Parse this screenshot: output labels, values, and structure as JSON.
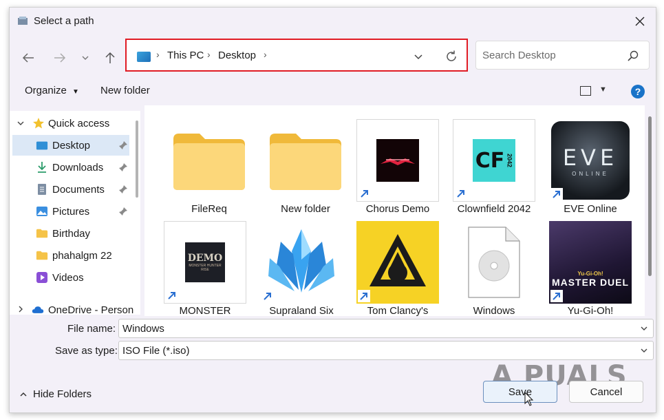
{
  "window": {
    "title": "Select a path"
  },
  "address": {
    "segments": [
      "This PC",
      "Desktop"
    ]
  },
  "search": {
    "placeholder": "Search Desktop"
  },
  "commandbar": {
    "organize": "Organize",
    "new_folder": "New folder"
  },
  "sidebar": {
    "quick_access": "Quick access",
    "items": [
      {
        "label": "Desktop",
        "icon": "desktop-icon",
        "pinned": true,
        "selected": true
      },
      {
        "label": "Downloads",
        "icon": "download-icon",
        "pinned": true
      },
      {
        "label": "Documents",
        "icon": "document-icon",
        "pinned": true
      },
      {
        "label": "Pictures",
        "icon": "pictures-icon",
        "pinned": true
      },
      {
        "label": "Birthday",
        "icon": "folder-icon"
      },
      {
        "label": "phahalgm 22",
        "icon": "folder-icon"
      },
      {
        "label": "Videos",
        "icon": "videos-icon"
      }
    ],
    "onedrive": "OneDrive - Person"
  },
  "files": [
    {
      "label": "FileReq",
      "kind": "folder"
    },
    {
      "label": "New folder",
      "kind": "folder"
    },
    {
      "label": "Chorus Demo",
      "kind": "shortcut"
    },
    {
      "label": "Clownfield 2042",
      "kind": "shortcut",
      "logo": "CF",
      "logo_sub": "2042"
    },
    {
      "label": "EVE Online",
      "kind": "shortcut",
      "logo": "EVE",
      "logo_sub": "ONLINE"
    },
    {
      "label": "MONSTER",
      "kind": "shortcut",
      "logo": "DEMO",
      "logo_sub": "MONSTER HUNTER RISE"
    },
    {
      "label": "Supraland Six",
      "kind": "shortcut"
    },
    {
      "label": "Tom Clancy's",
      "kind": "shortcut"
    },
    {
      "label": "Windows",
      "kind": "file"
    },
    {
      "label": "Yu-Gi-Oh!",
      "kind": "shortcut",
      "logo": "MASTER DUEL",
      "logo_sub": "Yu-Gi-Oh!"
    }
  ],
  "form": {
    "file_name_label": "File name:",
    "file_name_value": "Windows",
    "save_type_label": "Save as type:",
    "save_type_value": "ISO File (*.iso)"
  },
  "footer": {
    "hide_folders": "Hide Folders",
    "save": "Save",
    "cancel": "Cancel"
  },
  "watermark": "A  PUALS",
  "colors": {
    "highlight_border": "#e01b24",
    "selected_bg": "#dce8f6",
    "help": "#1a73c8"
  }
}
